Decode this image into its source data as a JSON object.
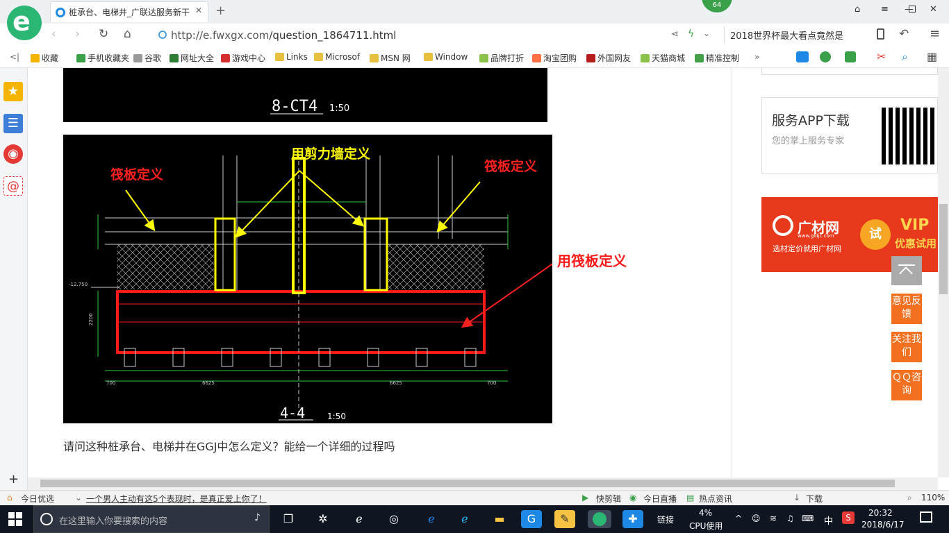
{
  "browser": {
    "tab_title": "桩承台、电梯井_广联达服务新干",
    "new_tab": "+",
    "badge": "64",
    "url_host": "http://e.fwxgx.com",
    "url_path": "/question_1864711.html",
    "search_text": "2018世界杯最大看点竟然是"
  },
  "bookmarks": [
    {
      "label": "收藏",
      "color": "#f5b400"
    },
    {
      "label": "手机收藏夹",
      "color": "#3aa14a"
    },
    {
      "label": "谷歌",
      "color": "#999999"
    },
    {
      "label": "网址大全",
      "color": "#2e7d32"
    },
    {
      "label": "游戏中心",
      "color": "#d32f2f"
    },
    {
      "label": "Links",
      "color": "#e8c040"
    },
    {
      "label": "Microsof",
      "color": "#e8c040"
    },
    {
      "label": "MSN 网",
      "color": "#e8c040"
    },
    {
      "label": "Window",
      "color": "#e8c040"
    },
    {
      "label": "品牌打折",
      "color": "#8bc34a"
    },
    {
      "label": "淘宝团购",
      "color": "#ff7043"
    },
    {
      "label": "外国网友",
      "color": "#b71c1c"
    },
    {
      "label": "天猫商城",
      "color": "#8bc34a"
    },
    {
      "label": "精准控制",
      "color": "#43a047"
    }
  ],
  "cad": {
    "top_label": "8-CT4",
    "top_scale": "1:50",
    "label_shear_wall": "用剪力墙定义",
    "label_raft_left": "筏板定义",
    "label_raft_right": "筏板定义",
    "label_raft_bottom": "用筏板定义",
    "section_label": "4-4",
    "section_scale": "1:50",
    "dim_left": "6625",
    "dim_right": "6625",
    "dim_edge_left": "700",
    "dim_edge_right": "700",
    "dim_height": "2200",
    "elev": "-12.750"
  },
  "question": "请问这种桩承台、电梯井在GGJ中怎么定义？能给一个详细的过程吗",
  "sidebar_right": {
    "app_title": "服务APP下载",
    "app_sub": "您的掌上服务专家",
    "ad_brand": "广材网",
    "ad_url": "www.gldjc.com",
    "ad_slogan": "选材定价就用广材网",
    "ad_try": "试",
    "ad_vip": "VIP",
    "ad_vip_sub": "优惠试用"
  },
  "float_buttons": [
    "意见反馈",
    "关注我们",
    "ＱＱ咨询"
  ],
  "statusbar": {
    "today": "今日优选",
    "news": "一个男人主动有这5个表现时，是真正爱上你了！",
    "clip": "快剪辑",
    "live": "今日直播",
    "hot": "热点资讯",
    "download": "下载",
    "zoom": "110%"
  },
  "taskbar": {
    "search_placeholder": "在这里输入你要搜索的内容",
    "link": "链接",
    "cpu_pct": "4%",
    "cpu_label": "CPU使用",
    "ime": "中",
    "time": "20:32",
    "date": "2018/6/17"
  }
}
